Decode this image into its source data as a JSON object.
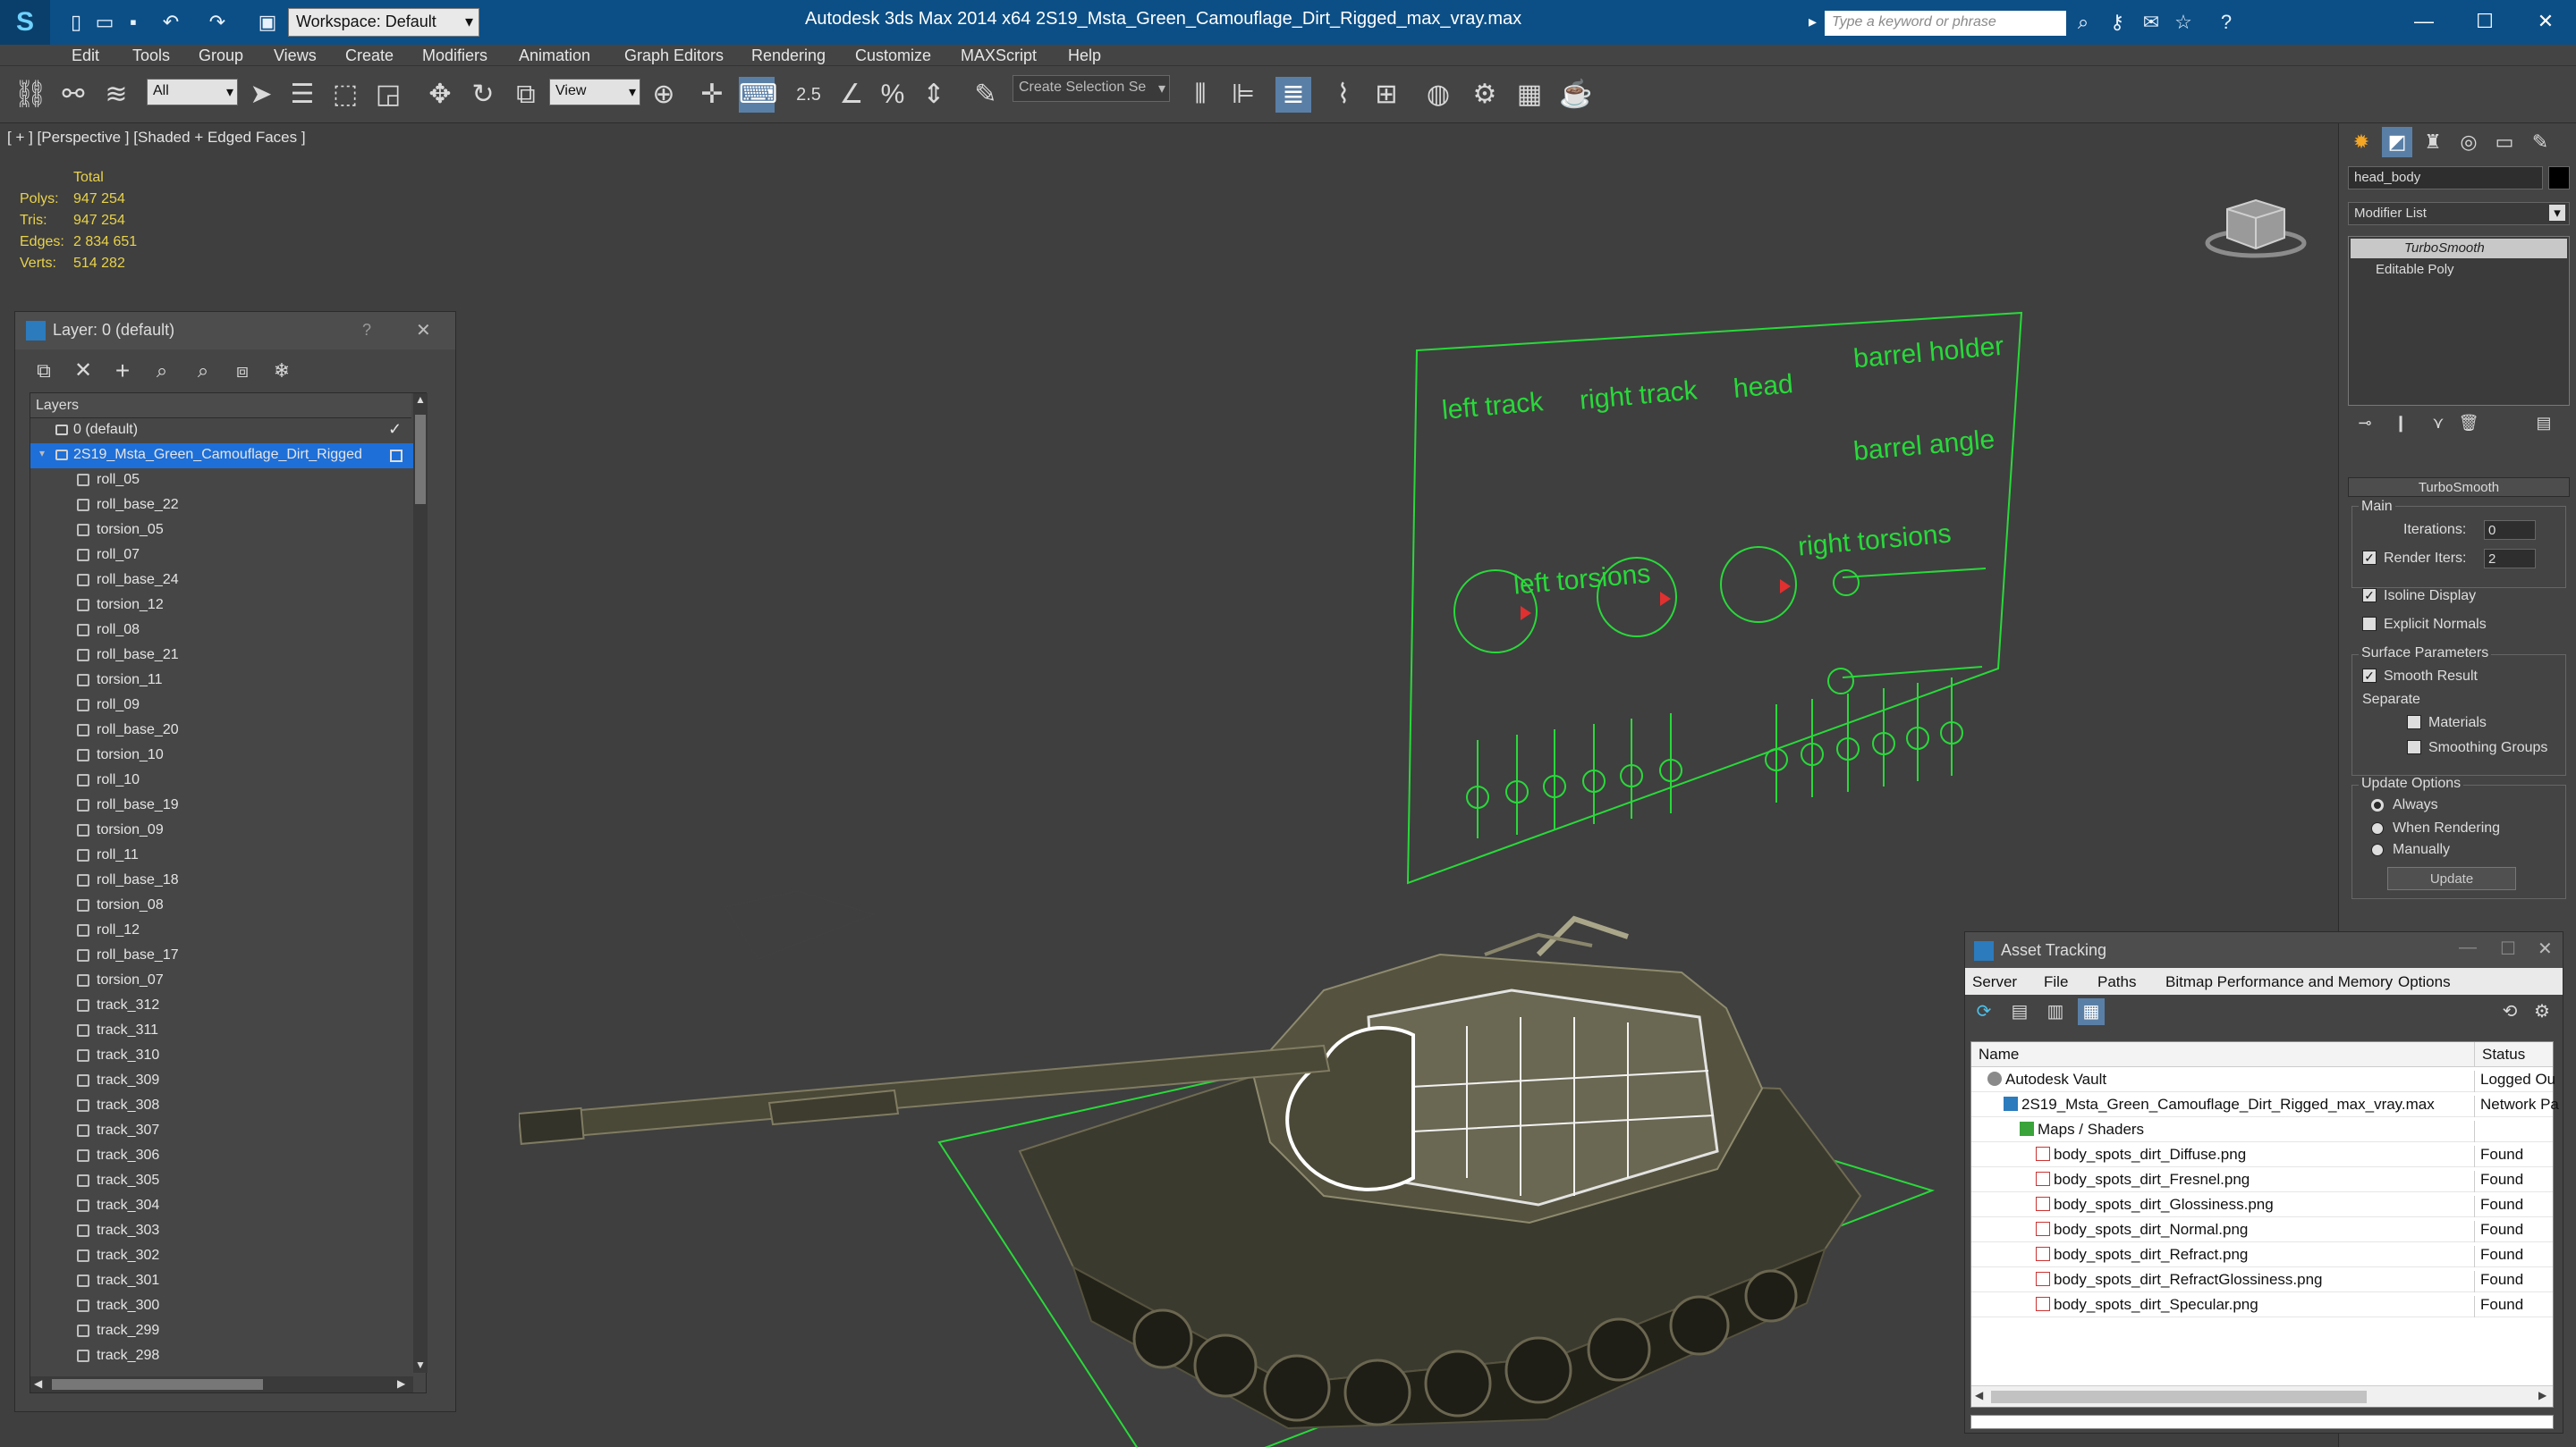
{
  "titlebar": {
    "title": "Autodesk 3ds Max  2014 x64     2S19_Msta_Green_Camouflage_Dirt_Rigged_max_vray.max",
    "workspace": "Workspace: Default",
    "search_placeholder": "Type a keyword or phrase"
  },
  "menubar": [
    "Edit",
    "Tools",
    "Group",
    "Views",
    "Create",
    "Modifiers",
    "Animation",
    "Graph Editors",
    "Rendering",
    "Customize",
    "MAXScript",
    "Help"
  ],
  "toolbar": {
    "filter": "All",
    "ref_coord": "View",
    "selection_set": "Create Selection Se",
    "snap_angle": "2.5"
  },
  "viewport": {
    "label": "[ + ] [Perspective ] [Shaded + Edged Faces ]",
    "stats": {
      "header": "Total",
      "polys_label": "Polys:",
      "polys": "947 254",
      "tris_label": "Tris:",
      "tris": "947 254",
      "edges_label": "Edges:",
      "edges": "2 834 651",
      "verts_label": "Verts:",
      "verts": "514 282"
    },
    "rig_labels": {
      "left_track": "left track",
      "right_track": "right track",
      "head": "head",
      "barrel_holder": "barrel holder",
      "barrel_angle": "barrel angle",
      "left_torsions": "left torsions",
      "right_torsions": "right torsions"
    }
  },
  "layer_panel": {
    "title": "Layer: 0 (default)",
    "help": "?",
    "header": "Layers",
    "layers": [
      {
        "name": "0 (default)"
      },
      {
        "name": "2S19_Msta_Green_Camouflage_Dirt_Rigged"
      }
    ],
    "items": [
      "roll_05",
      "roll_base_22",
      "torsion_05",
      "roll_07",
      "roll_base_24",
      "torsion_12",
      "roll_08",
      "roll_base_21",
      "torsion_11",
      "roll_09",
      "roll_base_20",
      "torsion_10",
      "roll_10",
      "roll_base_19",
      "torsion_09",
      "roll_11",
      "roll_base_18",
      "torsion_08",
      "roll_12",
      "roll_base_17",
      "torsion_07",
      "track_312",
      "track_311",
      "track_310",
      "track_309",
      "track_308",
      "track_307",
      "track_306",
      "track_305",
      "track_304",
      "track_303",
      "track_302",
      "track_301",
      "track_300",
      "track_299",
      "track_298"
    ]
  },
  "command_panel": {
    "object_name": "head_body",
    "modifier_list": "Modifier List",
    "stack": [
      "TurboSmooth",
      "Editable Poly"
    ],
    "rollout_title": "TurboSmooth",
    "main": "Main",
    "iterations_label": "Iterations:",
    "iterations": "0",
    "render_iters_label": "Render Iters:",
    "render_iters": "2",
    "isoline": "Isoline Display",
    "explicit_normals": "Explicit Normals",
    "surface_params": "Surface Parameters",
    "smooth_result": "Smooth Result",
    "separate": "Separate",
    "materials": "Materials",
    "smoothing_groups": "Smoothing Groups",
    "update_options": "Update Options",
    "always": "Always",
    "when_rendering": "When Rendering",
    "manually": "Manually",
    "update": "Update"
  },
  "asset_tracking": {
    "title": "Asset Tracking",
    "menu": [
      "Server",
      "File",
      "Paths",
      "Bitmap Performance and Memory",
      "Options"
    ],
    "col_name": "Name",
    "col_status": "Status",
    "rows": [
      {
        "name": "Autodesk Vault",
        "status": "Logged Ou"
      },
      {
        "name": "2S19_Msta_Green_Camouflage_Dirt_Rigged_max_vray.max",
        "status": "Network Pa"
      },
      {
        "name": "Maps / Shaders",
        "status": ""
      },
      {
        "name": "body_spots_dirt_Diffuse.png",
        "status": "Found"
      },
      {
        "name": "body_spots_dirt_Fresnel.png",
        "status": "Found"
      },
      {
        "name": "body_spots_dirt_Glossiness.png",
        "status": "Found"
      },
      {
        "name": "body_spots_dirt_Normal.png",
        "status": "Found"
      },
      {
        "name": "body_spots_dirt_Refract.png",
        "status": "Found"
      },
      {
        "name": "body_spots_dirt_RefractGlossiness.png",
        "status": "Found"
      },
      {
        "name": "body_spots_dirt_Specular.png",
        "status": "Found"
      }
    ]
  },
  "colors": {
    "titlebar": "#0c4f86",
    "rig_green": "#29d93a",
    "stats_yellow": "#e8d24a",
    "selection": "#1e6fd8"
  }
}
